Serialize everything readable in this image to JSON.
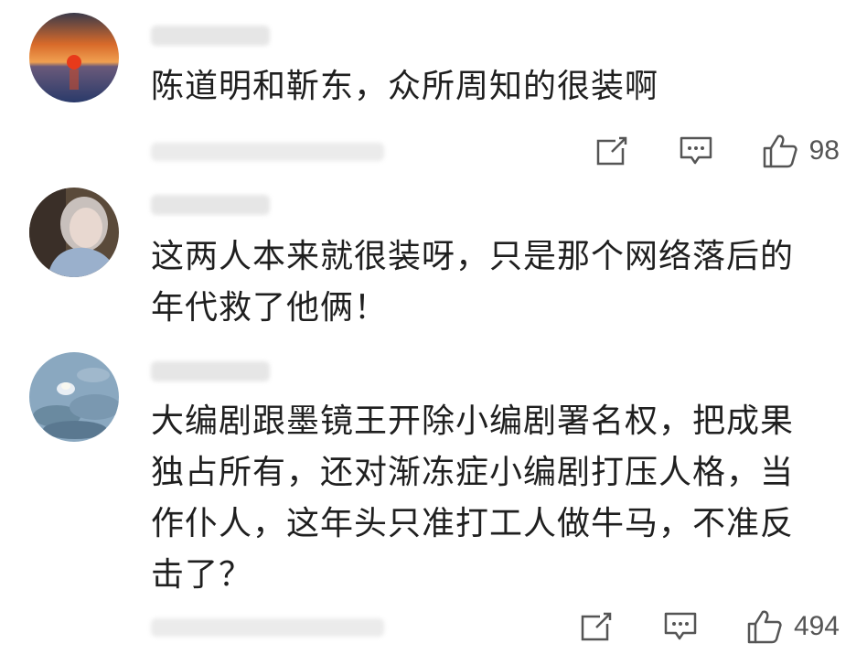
{
  "comments": [
    {
      "text": "陈道明和靳东，众所周知的很装啊",
      "likes": "98",
      "username_blurred": true,
      "meta_blurred": true
    },
    {
      "text": "这两人本来就很装呀，只是那个网络落后的\n年代救了他俩！",
      "likes": "",
      "username_blurred": true,
      "meta_blurred": false
    },
    {
      "text": "大编剧跟墨镜王开除小编剧署名权，把成果\n独占所有，还对渐冻症小编剧打压人格，当\n作仆人，这年头只准打工人做牛马，不准反\n击了？",
      "likes": "494",
      "username_blurred": true,
      "meta_blurred": true
    }
  ],
  "icons": {
    "share": "share-icon",
    "reply": "reply-icon",
    "like": "thumbs-up-icon"
  },
  "colors": {
    "text": "#1f1f1f",
    "icon": "#555555",
    "blur": "#e6e6e6"
  }
}
